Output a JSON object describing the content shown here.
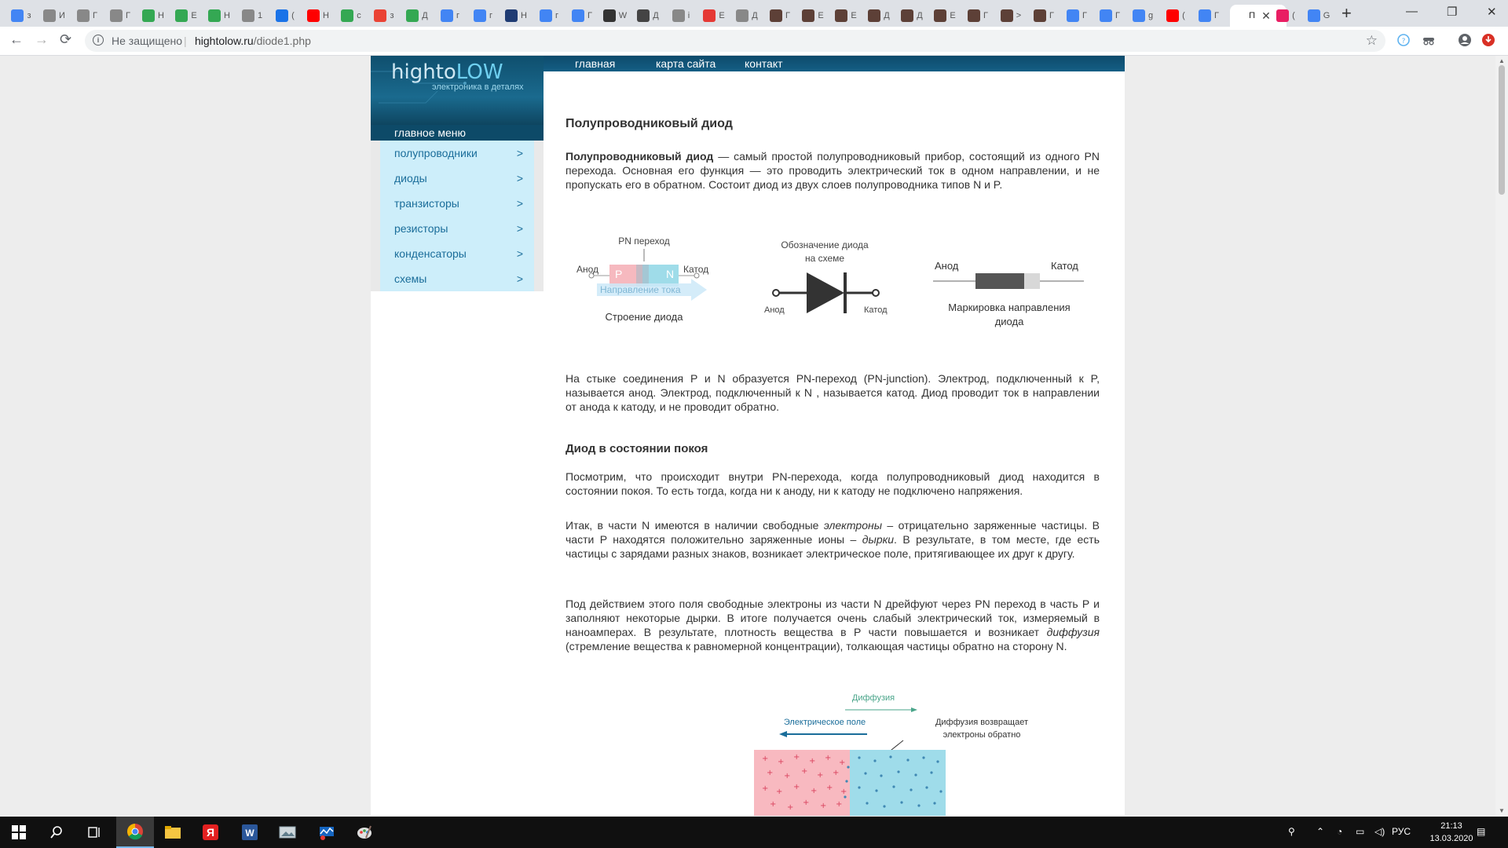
{
  "browser": {
    "tabs": [
      {
        "abbr": "з",
        "color": "#4285f4"
      },
      {
        "abbr": "И",
        "color": "#888888"
      },
      {
        "abbr": "Г",
        "color": "#888888"
      },
      {
        "abbr": "Г",
        "color": "#888888"
      },
      {
        "abbr": "Н",
        "color": "#34a853"
      },
      {
        "abbr": "Е",
        "color": "#34a853"
      },
      {
        "abbr": "Н",
        "color": "#34a853"
      },
      {
        "abbr": "1",
        "color": "#888888"
      },
      {
        "abbr": "(",
        "color": "#1a73e8"
      },
      {
        "abbr": "Н",
        "color": "#ff0000"
      },
      {
        "abbr": "с",
        "color": "#34a853"
      },
      {
        "abbr": "з",
        "color": "#ea4335"
      },
      {
        "abbr": "Д",
        "color": "#34a853"
      },
      {
        "abbr": "г",
        "color": "#4285f4"
      },
      {
        "abbr": "г",
        "color": "#4285f4"
      },
      {
        "abbr": "Н",
        "color": "#1f3b73"
      },
      {
        "abbr": "г",
        "color": "#4285f4"
      },
      {
        "abbr": "Г",
        "color": "#4285f4"
      },
      {
        "abbr": "W",
        "color": "#333333"
      },
      {
        "abbr": "Д",
        "color": "#444444"
      },
      {
        "abbr": "i",
        "color": "#888888"
      },
      {
        "abbr": "Е",
        "color": "#e53935"
      },
      {
        "abbr": "Д",
        "color": "#888888"
      },
      {
        "abbr": "Г",
        "color": "#5d4037"
      },
      {
        "abbr": "Е",
        "color": "#5d4037"
      },
      {
        "abbr": "Е",
        "color": "#5d4037"
      },
      {
        "abbr": "Д",
        "color": "#5d4037"
      },
      {
        "abbr": "Д",
        "color": "#5d4037"
      },
      {
        "abbr": "Е",
        "color": "#5d4037"
      },
      {
        "abbr": "Г",
        "color": "#5d4037"
      },
      {
        "abbr": ">",
        "color": "#5d4037"
      },
      {
        "abbr": "Г",
        "color": "#5d4037"
      },
      {
        "abbr": "Г",
        "color": "#4285f4"
      },
      {
        "abbr": "Г",
        "color": "#4285f4"
      },
      {
        "abbr": "g",
        "color": "#4285f4"
      },
      {
        "abbr": "(",
        "color": "#ff0000"
      },
      {
        "abbr": "Г",
        "color": "#4285f4"
      }
    ],
    "active_tab": {
      "abbr": "П",
      "close": "✕"
    },
    "after_tabs": [
      {
        "abbr": "(",
        "color": "#e91e63"
      },
      {
        "abbr": "G",
        "color": "#4285f4"
      }
    ],
    "new_tab": "+",
    "window_controls": [
      "—",
      "❐",
      "✕"
    ],
    "nav": {
      "back": "←",
      "forward": "→",
      "reload": "⟳"
    },
    "address": {
      "security": "Не защищено",
      "separator": "|",
      "host": "hightolow.ru",
      "path": "/diode1.php"
    }
  },
  "site": {
    "logo": {
      "high": "high",
      "to": "to",
      "low": "LOW",
      "tagline": "электроника в деталях"
    },
    "top_nav": [
      "главная",
      "карта сайта",
      "контакт"
    ],
    "menu_title": "главное меню",
    "menu": [
      {
        "label": "полупроводники",
        "chev": ">"
      },
      {
        "label": "диоды",
        "chev": ">"
      },
      {
        "label": "транзисторы",
        "chev": ">"
      },
      {
        "label": "резисторы",
        "chev": ">"
      },
      {
        "label": "конденсаторы",
        "chev": ">"
      },
      {
        "label": "схемы",
        "chev": ">"
      }
    ]
  },
  "article": {
    "title": "Полупроводниковый диод",
    "p1_bold": "Полупроводниковый диод",
    "p1_rest": " — самый простой полупроводниковый прибор, состоящий из одного PN перехода. Основная его функция — это проводить электрический ток в одном направлении, и не пропускать его в обратном. Состоит диод из двух слоев полупроводника типов N и P.",
    "fig1": {
      "pn_junction": "PN переход",
      "anode": "Анод",
      "cathode": "Катод",
      "p": "P",
      "n": "N",
      "current_dir": "Направление тока",
      "structure_caption": "Строение диода",
      "symbol_caption_1": "Обозначение диода",
      "symbol_caption_2": "на схеме",
      "symbol_anode": "Анод",
      "symbol_cathode": "Катод",
      "marking_anode": "Анод",
      "marking_cathode": "Катод",
      "marking_caption_1": "Маркировка направления",
      "marking_caption_2": "диода"
    },
    "p2": "На стыке соединения P и N образуется PN-переход (PN-junction). Электрод, подключенный к P, называется анод. Электрод, подключенный к N , называется катод. Диод проводит ток в направлении от анода к катоду, и не проводит обратно.",
    "h_rest": "Диод в состоянии покоя",
    "p3": "Посмотрим, что происходит внутри PN-перехода, когда полупроводниковый диод находится в состоянии покоя. То есть тогда, когда ни к аноду, ни к катоду не подключено напряжения.",
    "p4_a": "Итак, в части N имеются в наличии свободные ",
    "p4_em1": "электроны",
    "p4_b": " – отрицательно заряженные частицы. В части P находятся положительно заряженные ионы – ",
    "p4_em2": "дырки",
    "p4_c": ". В результате, в том месте, где есть частицы с зарядами разных знаков, возникает электрическое поле, притягивающее их друг к другу.",
    "p5_a": "Под действием этого поля свободные электроны из части N дрейфуют через PN переход в часть P и заполняют некоторые дырки. В итоге получается очень слабый электрический ток, измеряемый в наноамперах. В результате, плотность вещества в P части повышается и возникает ",
    "p5_em": "диффузия",
    "p5_b": " (стремление вещества к равномерной концентрации), толкающая частицы обратно на сторону N.",
    "fig2": {
      "diffusion": "Диффузия",
      "field": "Электрическое поле",
      "returns_1": "Диффузия возвращает",
      "returns_2": "электроны обратно"
    }
  },
  "taskbar": {
    "lang": "РУС",
    "time": "21:13",
    "date": "13.03.2020"
  }
}
